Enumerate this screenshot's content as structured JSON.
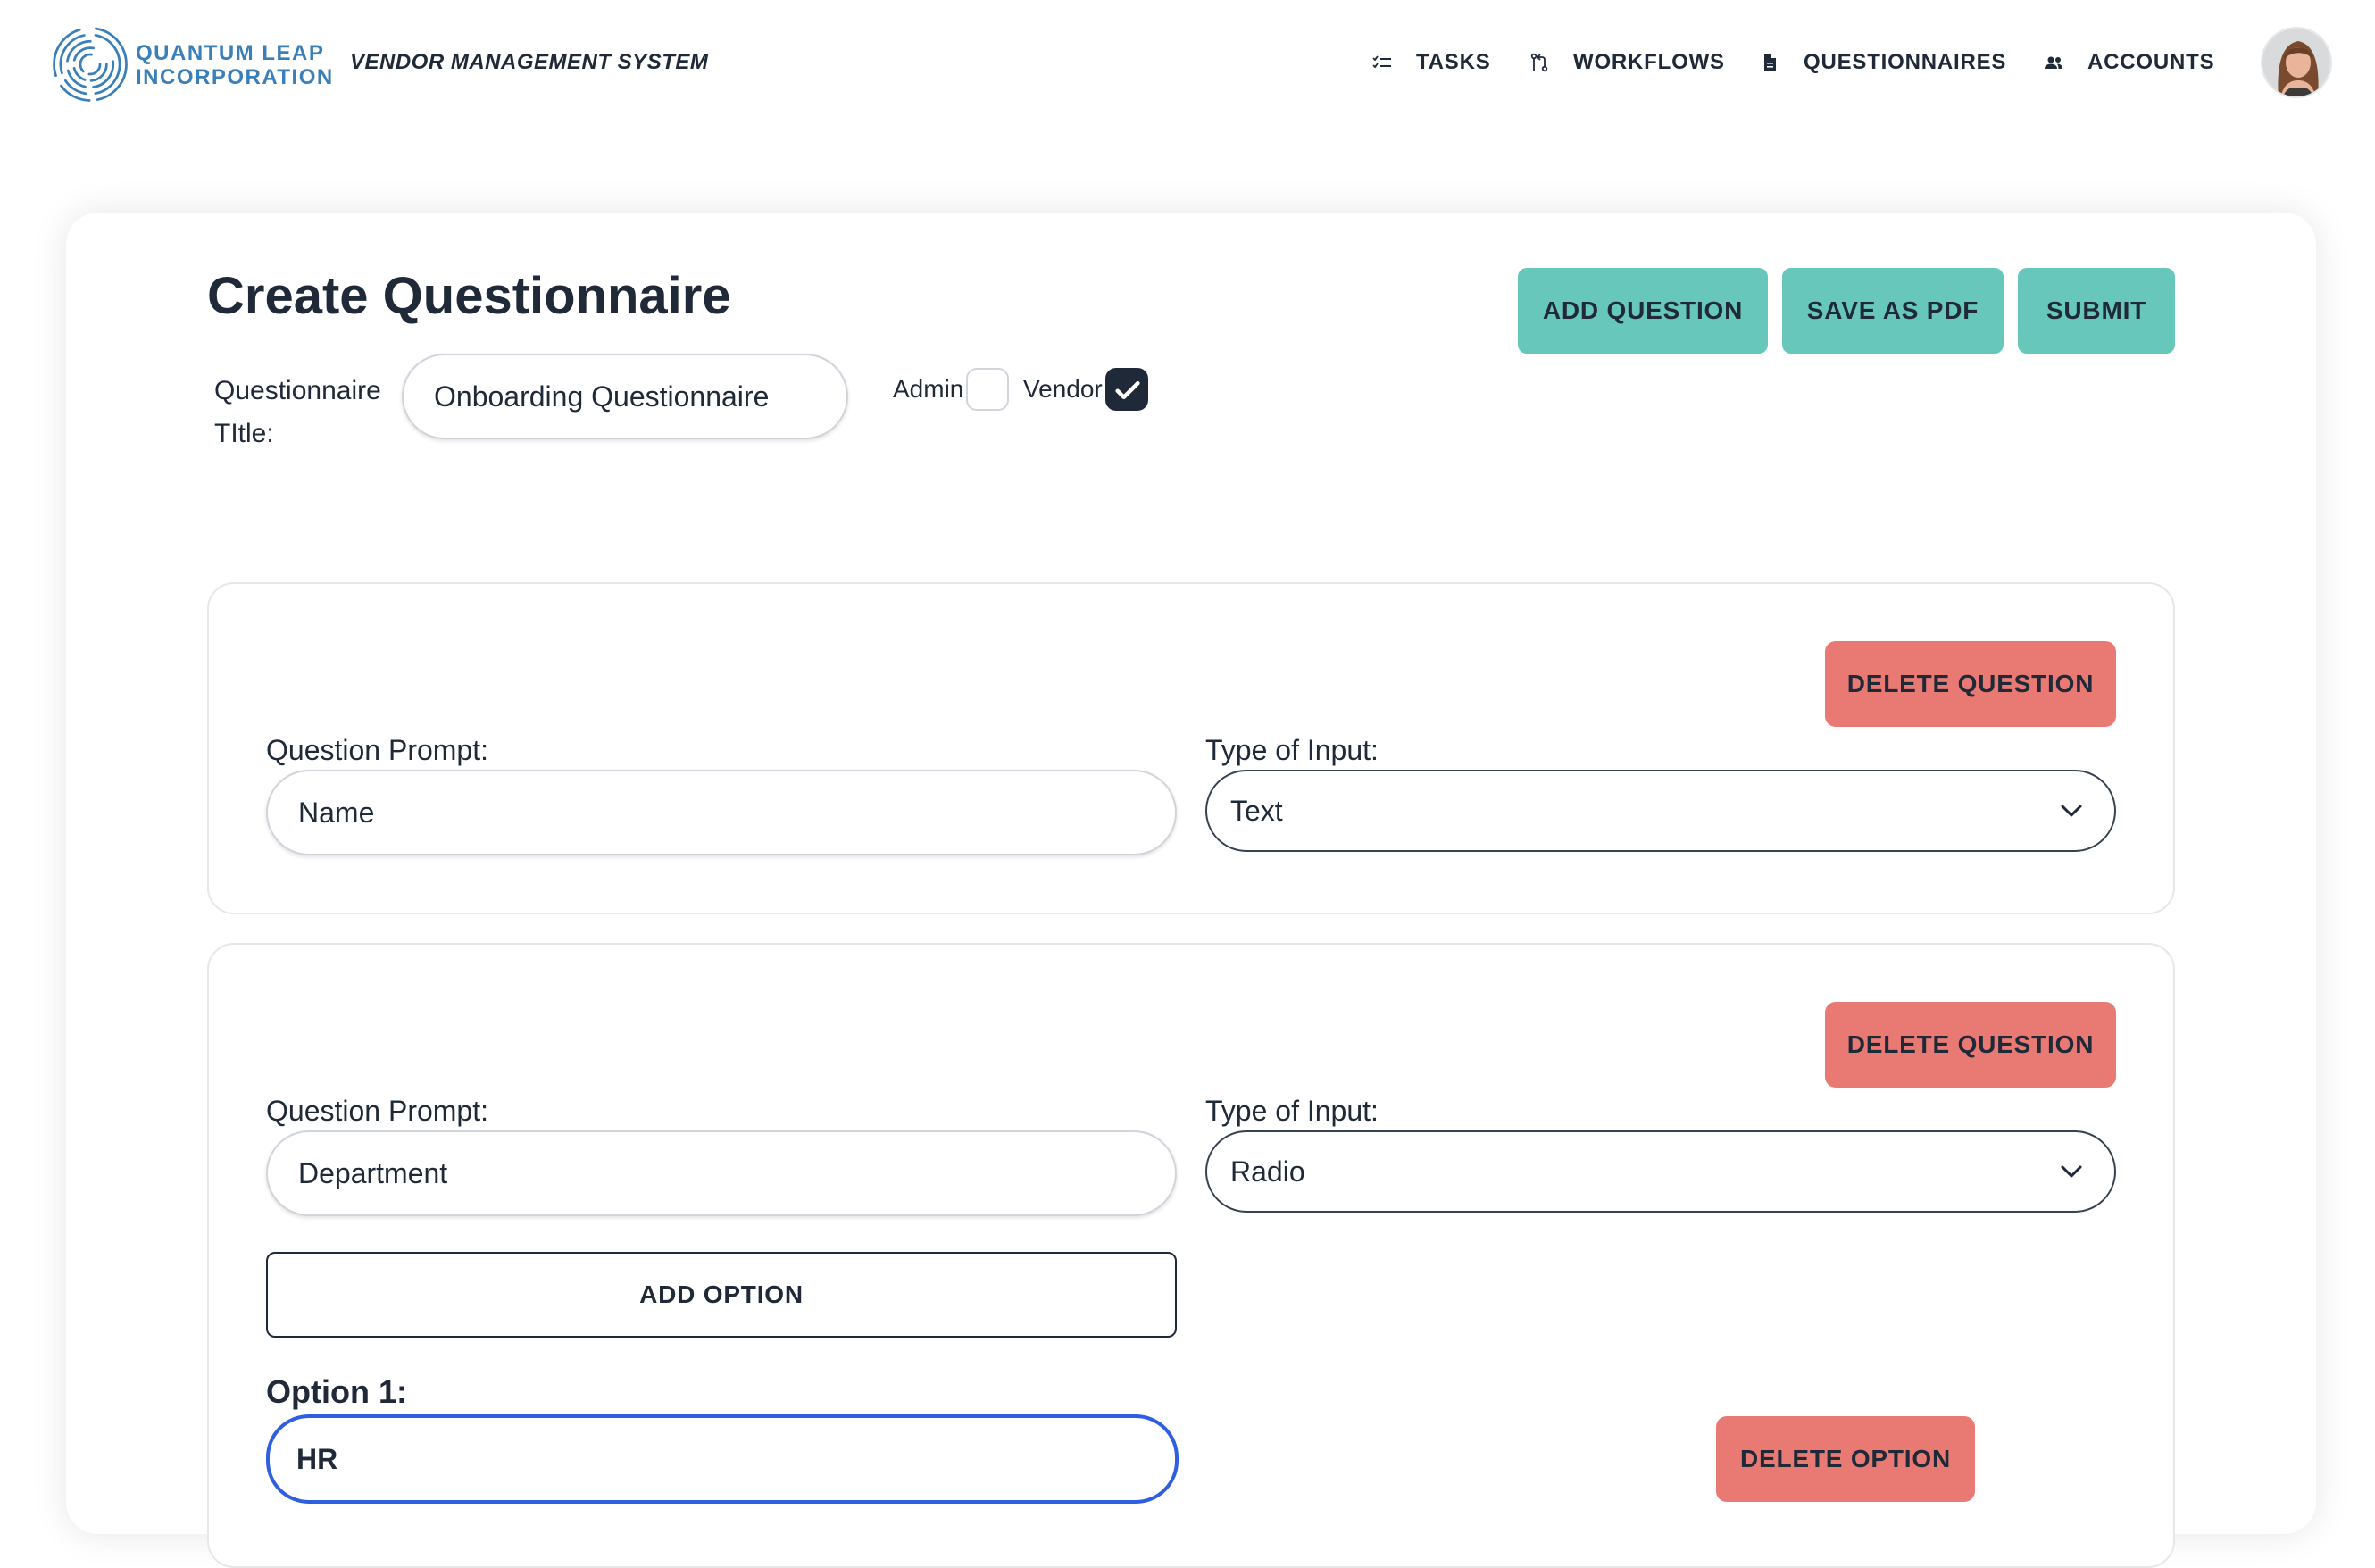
{
  "header": {
    "brand_line1": "QUANTUM LEAP",
    "brand_line2": "INCORPORATION",
    "system_title": "VENDOR MANAGEMENT SYSTEM",
    "nav": [
      {
        "label": "TASKS",
        "icon": "checklist-icon"
      },
      {
        "label": "WORKFLOWS",
        "icon": "workflow-icon"
      },
      {
        "label": "QUESTIONNAIRES",
        "icon": "document-icon"
      },
      {
        "label": "ACCOUNTS",
        "icon": "people-icon"
      }
    ]
  },
  "page": {
    "title": "Create Questionnaire",
    "actions": {
      "add_question": "ADD QUESTION",
      "save_pdf": "SAVE AS PDF",
      "submit": "SUBMIT"
    },
    "questionnaire_title_label": "Questionnaire TItle:",
    "questionnaire_title_value": "Onboarding Questionnaire",
    "roles": {
      "admin_label": "Admin",
      "admin_checked": false,
      "vendor_label": "Vendor",
      "vendor_checked": true
    }
  },
  "questions": [
    {
      "delete_label": "DELETE QUESTION",
      "prompt_label": "Question Prompt:",
      "prompt_value": "Name",
      "type_label": "Type of Input:",
      "type_value": "Text"
    },
    {
      "delete_label": "DELETE QUESTION",
      "prompt_label": "Question Prompt:",
      "prompt_value": "Department",
      "type_label": "Type of Input:",
      "type_value": "Radio",
      "add_option_label": "ADD OPTION",
      "options": [
        {
          "label": "Option 1:",
          "value": "HR",
          "delete_label": "DELETE OPTION"
        }
      ]
    }
  ],
  "colors": {
    "teal_button": "#67c7bb",
    "red_button": "#e97a73",
    "brand_blue": "#3a7fb8",
    "focus_blue": "#2f5ee0",
    "text_dark": "#1f2937"
  }
}
